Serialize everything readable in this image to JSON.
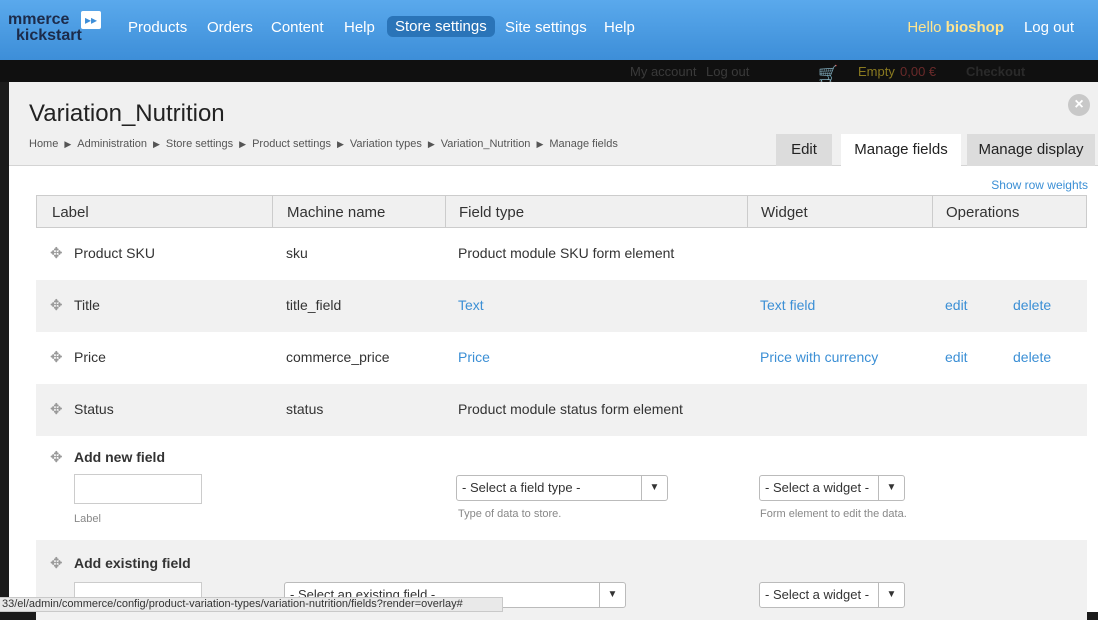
{
  "toolbar": {
    "logo_line1": "mmerce",
    "logo_line2": "kickstart",
    "logo_mark": "▸▸",
    "nav": [
      "Products",
      "Orders",
      "Content",
      "Help",
      "Store settings",
      "Site settings",
      "Help"
    ],
    "active_nav": "Store settings",
    "hello_prefix": "Hello ",
    "username": "bioshop",
    "logout": "Log out"
  },
  "background_bar": {
    "my_account": "My account",
    "log_out": "Log out",
    "cart_empty": "Empty",
    "cart_total": "0,00 €",
    "checkout": "Checkout"
  },
  "overlay": {
    "title": "Variation_Nutrition",
    "close_glyph": "×",
    "breadcrumb": [
      "Home",
      "Administration",
      "Store settings",
      "Product settings",
      "Variation types",
      "Variation_Nutrition",
      "Manage fields"
    ],
    "breadcrumb_separator": "▶",
    "tabs": [
      "Edit",
      "Manage fields",
      "Manage display"
    ],
    "active_tab": "Manage fields",
    "show_row_weights": "Show row weights"
  },
  "table": {
    "headers": [
      "Label",
      "Machine name",
      "Field type",
      "Widget",
      "Operations"
    ],
    "rows": [
      {
        "label": "Product SKU",
        "machine": "sku",
        "type": "Product module SKU form element",
        "type_link": false,
        "widget": "",
        "edit": "",
        "delete": ""
      },
      {
        "label": "Title",
        "machine": "title_field",
        "type": "Text",
        "type_link": true,
        "widget": "Text field",
        "edit": "edit",
        "delete": "delete"
      },
      {
        "label": "Price",
        "machine": "commerce_price",
        "type": "Price",
        "type_link": true,
        "widget": "Price with currency",
        "edit": "edit",
        "delete": "delete"
      },
      {
        "label": "Status",
        "machine": "status",
        "type": "Product module status form element",
        "type_link": false,
        "widget": "",
        "edit": "",
        "delete": ""
      }
    ],
    "add_new": {
      "title": "Add new field",
      "label_help": "Label",
      "field_type_select": "- Select a field type -",
      "field_type_help": "Type of data to store.",
      "widget_select": "- Select a widget -",
      "widget_help": "Form element to edit the data."
    },
    "add_existing": {
      "title": "Add existing field",
      "existing_select": "- Select an existing field -",
      "widget_select": "- Select a widget -"
    }
  },
  "status_url": "33/el/admin/commerce/config/product-variation-types/variation-nutrition/fields?render=overlay#",
  "colors": {
    "toolbar": "#3d8ed8",
    "link": "#3b8fd5",
    "hello": "#ffe590"
  }
}
